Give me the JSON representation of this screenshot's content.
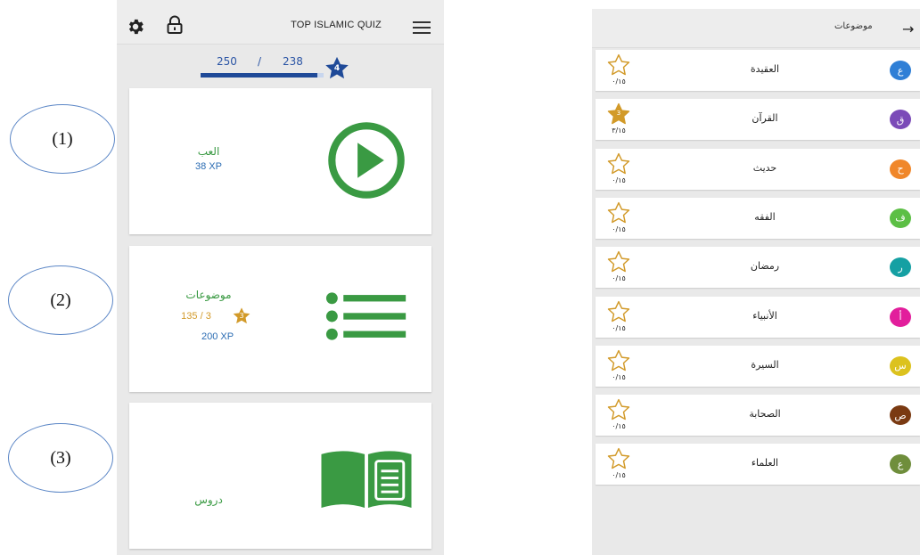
{
  "annotations": [
    "(1)",
    "(2)",
    "(3)"
  ],
  "home": {
    "app_title": "TOP ISLAMIC QUIZ",
    "xp_goal": "250",
    "xp_separator": "/",
    "xp_current": "238",
    "xp_progress": 0.95,
    "level": "4",
    "play": {
      "label": "العب",
      "xp": "38 XP"
    },
    "topics": {
      "label": "موضوعات",
      "progress": "135 / 3",
      "star_count": "3",
      "xp": "200 XP"
    },
    "lessons": {
      "label": "دروس"
    }
  },
  "topics_screen": {
    "title": "موضوعات",
    "back_icon": "arrow-right-icon",
    "items": [
      {
        "name": "العقيدة",
        "letter": "ع",
        "color": "#2f7fd6",
        "score": "٠/١٥",
        "stars": ""
      },
      {
        "name": "القرآن",
        "letter": "ق",
        "color": "#7b4bb8",
        "score": "٣/١٥",
        "stars": "3"
      },
      {
        "name": "حديث",
        "letter": "ح",
        "color": "#f0872a",
        "score": "٠/١٥",
        "stars": ""
      },
      {
        "name": "الفقه",
        "letter": "ف",
        "color": "#5cbf45",
        "score": "٠/١٥",
        "stars": ""
      },
      {
        "name": "رمضان",
        "letter": "ر",
        "color": "#15a0a3",
        "score": "٠/١٥",
        "stars": ""
      },
      {
        "name": "الأنبياء",
        "letter": "أ",
        "color": "#e21e9c",
        "score": "٠/١٥",
        "stars": ""
      },
      {
        "name": "السيرة",
        "letter": "س",
        "color": "#dcc21e",
        "score": "٠/١٥",
        "stars": ""
      },
      {
        "name": "الصحابة",
        "letter": "ص",
        "color": "#7a3a12",
        "score": "٠/١٥",
        "stars": ""
      },
      {
        "name": "العلماء",
        "letter": "ع",
        "color": "#6f8e3c",
        "score": "٠/١٥",
        "stars": ""
      }
    ]
  },
  "colors": {
    "green": "#3a9a43",
    "blue": "#2b6cb3",
    "navy": "#1f4a98",
    "gold": "#d29a29"
  }
}
